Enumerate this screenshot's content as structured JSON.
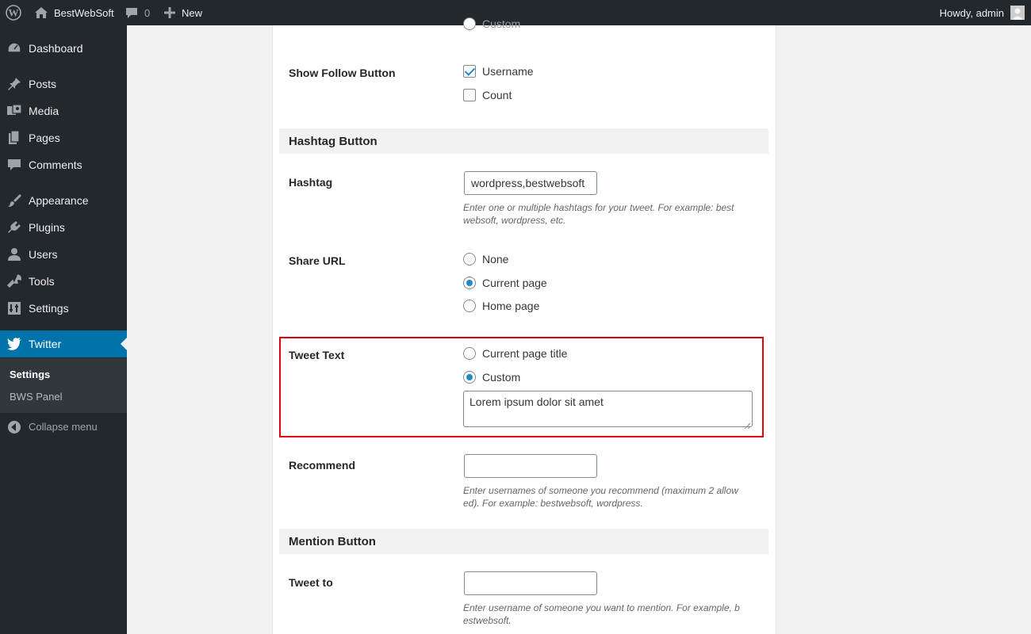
{
  "admin_bar": {
    "site_name": "BestWebSoft",
    "comments_count": "0",
    "new_label": "New",
    "greeting": "Howdy, admin"
  },
  "sidebar": {
    "items": [
      {
        "label": "Dashboard",
        "icon": "dashboard-icon"
      },
      {
        "label": "Posts",
        "icon": "pin-icon"
      },
      {
        "label": "Media",
        "icon": "media-icon"
      },
      {
        "label": "Pages",
        "icon": "pages-icon"
      },
      {
        "label": "Comments",
        "icon": "comment-icon"
      },
      {
        "label": "Appearance",
        "icon": "brush-icon"
      },
      {
        "label": "Plugins",
        "icon": "plugin-icon"
      },
      {
        "label": "Users",
        "icon": "user-icon"
      },
      {
        "label": "Tools",
        "icon": "wrench-icon"
      },
      {
        "label": "Settings",
        "icon": "settings-icon"
      },
      {
        "label": "Twitter",
        "icon": "twitter-bird-icon"
      }
    ],
    "submenu": [
      "Settings",
      "BWS Panel"
    ],
    "collapse_label": "Collapse menu",
    "accent_color": "#0073aa"
  },
  "form": {
    "top_partial_option": "Custom",
    "show_follow": {
      "label": "Show Follow Button",
      "options": [
        {
          "label": "Username",
          "checked": true
        },
        {
          "label": "Count",
          "checked": false
        }
      ]
    },
    "hashtag_section": "Hashtag Button",
    "hashtag": {
      "label": "Hashtag",
      "value": "wordpress,bestwebsoft",
      "description_line1": "Enter one or multiple hashtags for your tweet. For example: best",
      "description_line2": "websoft, wordpress, etc."
    },
    "share_url": {
      "label": "Share URL",
      "options": [
        "None",
        "Current page",
        "Home page"
      ],
      "selected": "Current page"
    },
    "tweet_text": {
      "label": "Tweet Text",
      "options": [
        "Current page title",
        "Custom"
      ],
      "selected": "Custom",
      "custom_value": "Lorem ipsum dolor sit amet",
      "highlight_color": "#e2000e"
    },
    "recommend": {
      "label": "Recommend",
      "value": "",
      "description_line1": "Enter usernames of someone you recommend (maximum 2 allow",
      "description_line2": "ed). For example: bestwebsoft, wordpress."
    },
    "mention_section": "Mention Button",
    "tweet_to": {
      "label": "Tweet to",
      "value": "",
      "description_line1": "Enter username of someone you want to mention. For example, b",
      "description_line2": "estwebsoft."
    }
  }
}
